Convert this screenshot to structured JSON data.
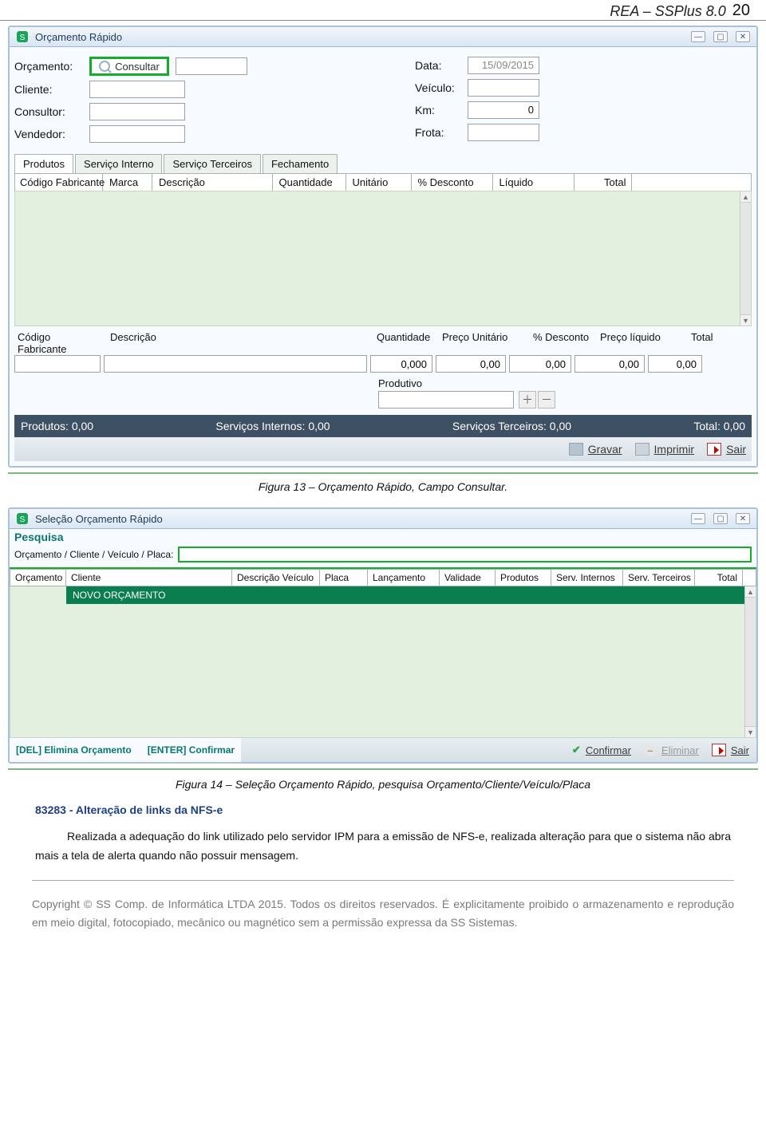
{
  "header": {
    "doc": "REA – SSPlus 8.0",
    "page": "20"
  },
  "win1": {
    "title": "Orçamento Rápido",
    "labels": {
      "orc": "Orçamento:",
      "cli": "Cliente:",
      "cons": "Consultor:",
      "vend": "Vendedor:",
      "data": "Data:",
      "veic": "Veículo:",
      "km": "Km:",
      "frota": "Frota:"
    },
    "consultBtn": "Consultar",
    "dataVal": "15/09/2015",
    "kmVal": "0",
    "tabs": [
      "Produtos",
      "Serviço Interno",
      "Serviço Terceiros",
      "Fechamento"
    ],
    "thead": [
      "Código Fabricante",
      "Marca",
      "Descrição",
      "Quantidade",
      "Unitário",
      "% Desconto",
      "Líquido",
      "Total"
    ],
    "thead2": [
      "Código Fabricante",
      "Descrição",
      "Quantidade",
      "Preço Unitário",
      "% Desconto",
      "Preço líquido",
      "Total"
    ],
    "vals": {
      "qt": "0,000",
      "pu": "0,00",
      "desc": "0,00",
      "liq": "0,00",
      "tot": "0,00"
    },
    "produtivo": "Produtivo",
    "totals": {
      "prod": "Produtos: 0,00",
      "si": "Serviços Internos: 0,00",
      "st": "Serviços Terceiros: 0,00",
      "tot": "Total: 0,00"
    },
    "actions": {
      "gravar": "Gravar",
      "imprimir": "Imprimir",
      "sair": "Sair"
    },
    "caption": "Figura 13 – Orçamento Rápido, Campo Consultar."
  },
  "win2": {
    "title": "Seleção Orçamento Rápido",
    "sub": "Pesquisa",
    "searchLabel": "Orçamento / Cliente / Veículo / Placa:",
    "thead": [
      "Orçamento",
      "Cliente",
      "Descrição Veículo",
      "Placa",
      "Lançamento",
      "Validade",
      "Produtos",
      "Serv. Internos",
      "Serv. Terceiros",
      "Total"
    ],
    "rowNovo": "NOVO ORÇAMENTO",
    "hints": {
      "del": "[DEL] Elimina Orçamento",
      "enter": "[ENTER] Confirmar"
    },
    "actions": {
      "conf": "Confirmar",
      "elim": "Eliminar",
      "sair": "Sair"
    },
    "caption": "Figura 14 – Seleção Orçamento Rápido, pesquisa Orçamento/Cliente/Veículo/Placa"
  },
  "section": {
    "title": "83283 - Alteração de links da NFS-e",
    "para": "Realizada a adequação do link utilizado pelo servidor IPM para a emissão de NFS-e, realizada alteração para que o sistema não abra mais a tela de alerta quando não possuir mensagem."
  },
  "footer": "Copyright © SS Comp. de Informática LTDA 2015. Todos os direitos reservados. É explicitamente proibido o armazenamento e reprodução em meio digital, fotocopiado, mecânico ou magnético sem a permissão expressa da SS Sistemas."
}
